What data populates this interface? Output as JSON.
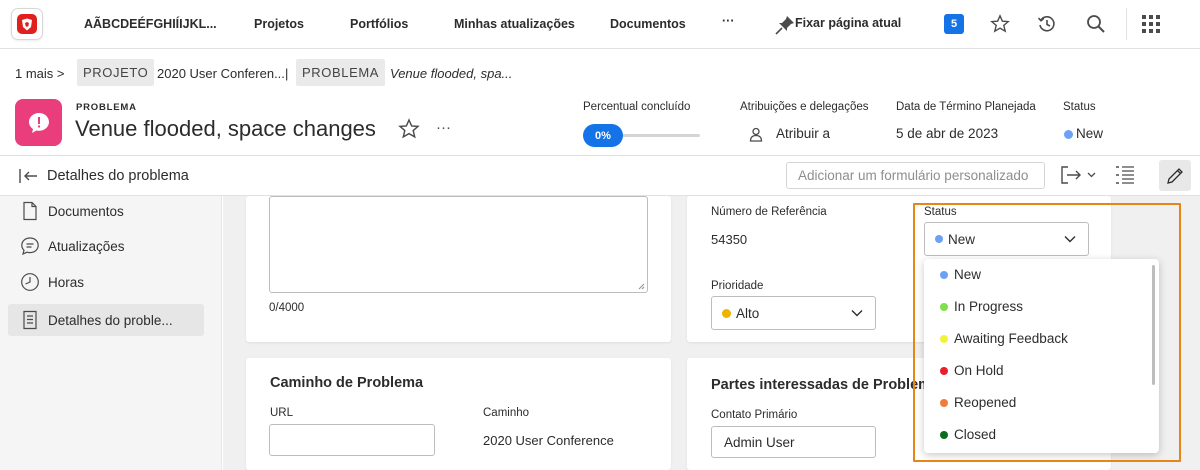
{
  "topnav": {
    "org": "AÃBCDEÉFGHIÍIJKL...",
    "items": [
      "Projetos",
      "Portfólios",
      "Minhas atualizações",
      "Documentos"
    ],
    "more": "···",
    "pin": "Fixar página atual",
    "badge": "5"
  },
  "breadcrumb": {
    "more": "1 mais",
    "arrow": ">",
    "project_tag": "PROJETO",
    "project_name": "2020 User Conferen...",
    "sep": "|",
    "issue_tag": "PROBLEMA",
    "issue_name": "Venue flooded, spa..."
  },
  "header": {
    "kicker": "PROBLEMA",
    "title": "Venue flooded, space changes",
    "more": "···",
    "percent_label": "Percentual concluído",
    "percent_value": "0%",
    "assign_label": "Atribuições e delegações",
    "assign_value": "Atribuir a",
    "due_label": "Data de Término Planejada",
    "due_value": "5 de abr de 2023",
    "status_label": "Status",
    "status_value": "New"
  },
  "subbar": {
    "title": "Detalhes do problema",
    "custom_form": "Adicionar um formulário personalizado"
  },
  "sidebar": {
    "items": [
      {
        "label": "Documentos",
        "icon": "document-icon"
      },
      {
        "label": "Atualizações",
        "icon": "chat-bubble-icon"
      },
      {
        "label": "Horas",
        "icon": "clock-icon"
      },
      {
        "label": "Detalhes do proble...",
        "icon": "details-icon"
      }
    ]
  },
  "details": {
    "char_count": "0/4000",
    "ref_label": "Número de Referência",
    "ref_value": "54350",
    "status_label": "Status",
    "status_value": "New",
    "priority_label": "Prioridade",
    "priority_value": "Alto"
  },
  "path_card": {
    "title": "Caminho de Problema",
    "url_label": "URL",
    "path_label": "Caminho",
    "path_value": "2020 User Conference"
  },
  "stakeholders": {
    "title": "Partes interessadas de Problem",
    "contact_label": "Contato Primário",
    "contact_value": "Admin User"
  },
  "status_dropdown": {
    "options": [
      {
        "label": "New",
        "color": "#6ea0f5"
      },
      {
        "label": "In Progress",
        "color": "#7ee04a"
      },
      {
        "label": "Awaiting Feedback",
        "color": "#f2f23a"
      },
      {
        "label": "On Hold",
        "color": "#e8202a"
      },
      {
        "label": "Reopened",
        "color": "#f07c3c"
      },
      {
        "label": "Closed",
        "color": "#0e6b1e"
      }
    ]
  },
  "colors": {
    "accent": "#1473e6",
    "issue_icon": "#ea3d7c",
    "priority_dot": "#f0b400",
    "highlight": "#e68619"
  },
  "progress": {
    "fraction": 0
  }
}
